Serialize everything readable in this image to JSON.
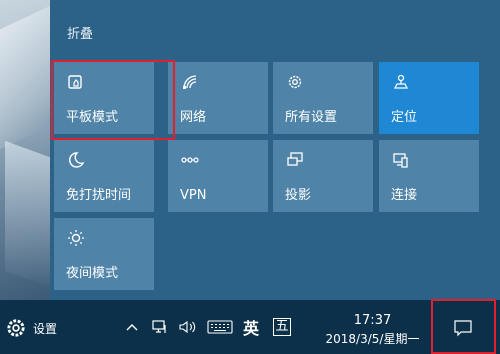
{
  "header": {
    "collapse_label": "折叠"
  },
  "tiles": [
    {
      "label": "平板模式",
      "icon": "tablet-mode-icon",
      "active": false,
      "highlighted": true
    },
    {
      "label": "网络",
      "icon": "network-icon",
      "active": false
    },
    {
      "label": "所有设置",
      "icon": "gear-icon",
      "active": false
    },
    {
      "label": "定位",
      "icon": "location-icon",
      "active": true
    },
    {
      "label": "免打扰时间",
      "icon": "moon-icon",
      "active": false
    },
    {
      "label": "VPN",
      "icon": "vpn-icon",
      "active": false
    },
    {
      "label": "投影",
      "icon": "project-icon",
      "active": false
    },
    {
      "label": "连接",
      "icon": "connect-icon",
      "active": false
    },
    {
      "label": "夜间模式",
      "icon": "brightness-icon",
      "active": false
    }
  ],
  "taskbar": {
    "settings_label": "设置",
    "ime_lang": "英",
    "ime_mode": "五",
    "clock_time": "17:37",
    "clock_date": "2018/3/5/星期一"
  },
  "colors": {
    "panel_bg": "#2c6287",
    "tile_bg": "#4f83a8",
    "tile_active_bg": "#1e88d4",
    "taskbar_bg": "#0c2f4a",
    "highlight_red": "#e0202c"
  }
}
